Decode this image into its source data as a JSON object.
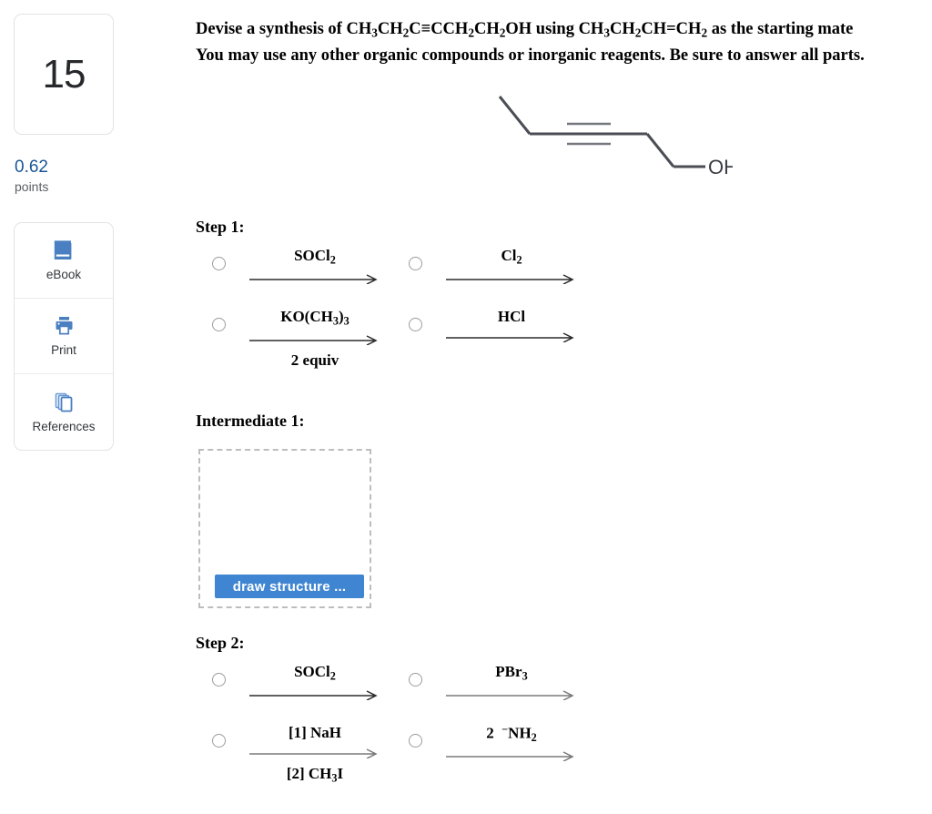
{
  "sidebar": {
    "question_number": "15",
    "points_value": "0.62",
    "points_label": "points",
    "points_color": "#1b5695",
    "tools": [
      {
        "label": "eBook",
        "icon": "book-icon"
      },
      {
        "label": "Print",
        "icon": "printer-icon"
      },
      {
        "label": "References",
        "icon": "pages-icon"
      }
    ]
  },
  "prompt": {
    "line1_a": "Devise a synthesis of CH",
    "line1_full": "Devise a synthesis of CH3CH2C≡CCH2CH2OH using CH3CH2CH=CH2 as the starting mate",
    "line2": "You may use any other organic compounds or inorganic reagents. Be sure to answer all parts."
  },
  "molecule": {
    "name": "hex-3-yn-1-ol-skeletal-structure",
    "label_oh": "OH",
    "bond_color": "#4b4d55"
  },
  "step1": {
    "heading": "Step 1:",
    "options": [
      {
        "above": "SOCl2",
        "below": "",
        "selected": false
      },
      {
        "above": "Cl2",
        "below": "",
        "selected": false
      },
      {
        "above": "KO(CH3)3",
        "below": "2 equiv",
        "selected": false
      },
      {
        "above": "HCl",
        "below": "",
        "selected": false
      }
    ]
  },
  "intermediate1": {
    "heading": "Intermediate 1:",
    "draw_button_label": "draw structure ...",
    "draw_button_color": "#3f85d1"
  },
  "step2": {
    "heading": "Step 2:",
    "options": [
      {
        "above": "SOCl2",
        "below": "",
        "selected": false
      },
      {
        "above": "PBr3",
        "below": "",
        "selected": false
      },
      {
        "above": "[1] NaH",
        "below": "[2] CH3I",
        "selected": false
      },
      {
        "above": "2 ⁻NH2",
        "below": "",
        "selected": false
      }
    ]
  }
}
